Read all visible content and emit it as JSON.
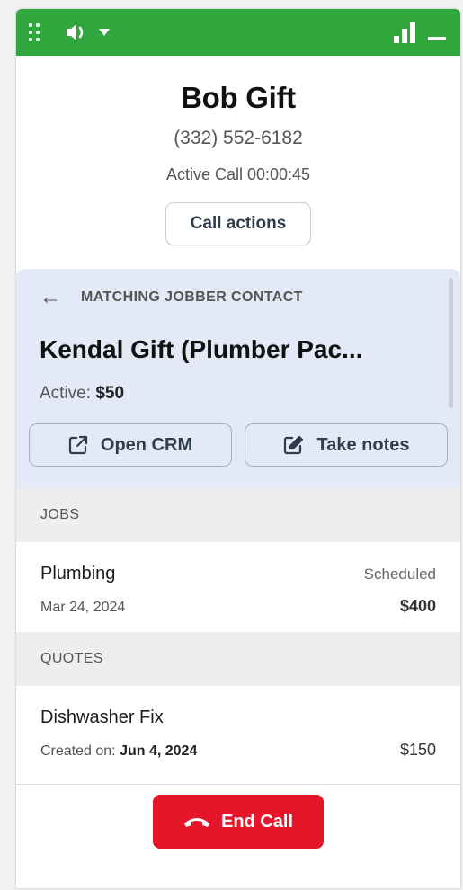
{
  "caller": {
    "name": "Bob Gift",
    "phone": "(332) 552-6182",
    "status": "Active Call 00:00:45",
    "call_actions_label": "Call actions"
  },
  "contact": {
    "section_label": "MATCHING JOBBER CONTACT",
    "name": "Kendal Gift (Plumber Pac...",
    "balance_label": "Active:",
    "balance_value": "$50",
    "open_crm_label": "Open CRM",
    "take_notes_label": "Take notes"
  },
  "jobs": {
    "header": "JOBS",
    "items": [
      {
        "title": "Plumbing",
        "status": "Scheduled",
        "date": "Mar 24, 2024",
        "amount": "$400"
      }
    ]
  },
  "quotes": {
    "header": "QUOTES",
    "items": [
      {
        "title": "Dishwasher Fix",
        "created_label": "Created on:",
        "created_date": "Jun 4, 2024",
        "amount": "$150"
      }
    ]
  },
  "end_call_label": "End Call",
  "colors": {
    "titlebar": "#2fa73c",
    "contact_card": "#e4e9f8",
    "end_call": "#e5152a"
  },
  "icons": [
    "drag-handle-icon",
    "speaker-icon",
    "caret-down-icon",
    "signal-icon",
    "minimize-icon",
    "back-arrow-icon",
    "external-link-icon",
    "edit-icon",
    "phone-hangup-icon"
  ]
}
